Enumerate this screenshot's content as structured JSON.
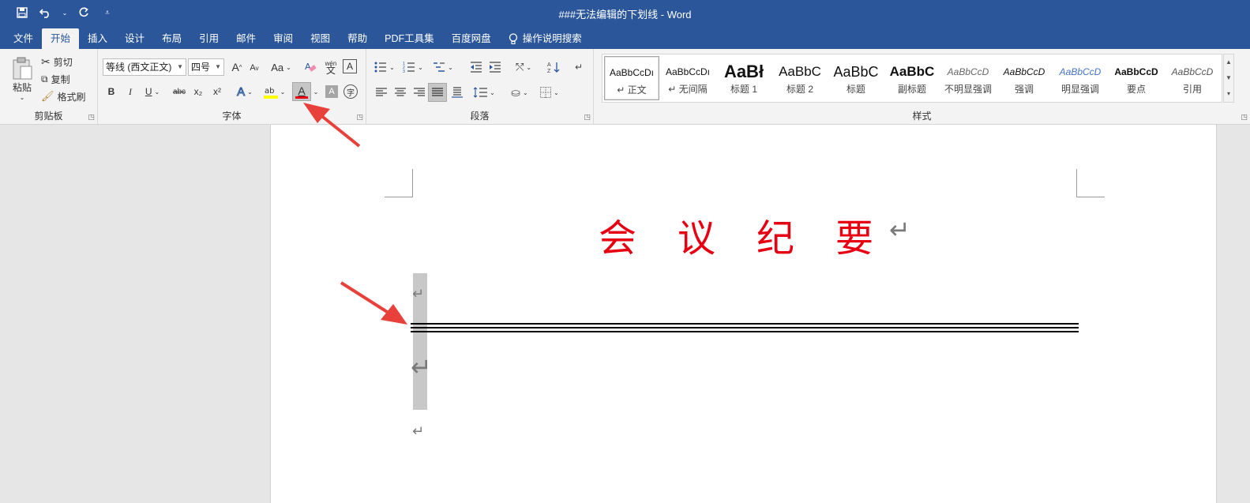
{
  "window": {
    "title": "###无法编辑的下划线  -  Word"
  },
  "qat": {
    "save_icon": "save-icon",
    "undo_icon": "undo-icon",
    "redo_icon": "redo-icon",
    "customize_icon": "customize-icon"
  },
  "tabs": [
    {
      "label": "文件"
    },
    {
      "label": "开始"
    },
    {
      "label": "插入"
    },
    {
      "label": "设计"
    },
    {
      "label": "布局"
    },
    {
      "label": "引用"
    },
    {
      "label": "邮件"
    },
    {
      "label": "审阅"
    },
    {
      "label": "视图"
    },
    {
      "label": "帮助"
    },
    {
      "label": "PDF工具集"
    },
    {
      "label": "百度网盘"
    }
  ],
  "tell_me": {
    "label": "操作说明搜索"
  },
  "clipboard": {
    "group_label": "剪贴板",
    "paste": "粘贴",
    "cut": "剪切",
    "copy": "复制",
    "format_painter": "格式刷"
  },
  "font": {
    "group_label": "字体",
    "font_name": "等线 (西文正文)",
    "font_size": "四号",
    "bold": "B",
    "italic": "I",
    "underline": "U",
    "strike": "abc",
    "subscript": "x₂",
    "superscript": "x²",
    "case": "Aa",
    "font_color_glyph": "A",
    "wen": "wén",
    "grow": "A",
    "shrink": "A",
    "font_color": "#e60012",
    "highlight_color": "#ffff00"
  },
  "paragraph": {
    "group_label": "段落"
  },
  "styles": {
    "group_label": "样式",
    "items": [
      {
        "sample": "AaBbCcDı",
        "name": "↵ 正文"
      },
      {
        "sample": "AaBbCcDı",
        "name": "↵ 无间隔"
      },
      {
        "sample": "AaBł",
        "name": "标题 1"
      },
      {
        "sample": "AaBbC",
        "name": "标题 2"
      },
      {
        "sample": "AaBbC",
        "name": "标题"
      },
      {
        "sample": "AaBbC",
        "name": "副标题"
      },
      {
        "sample": "AaBbCcD",
        "name": "不明显强调"
      },
      {
        "sample": "AaBbCcD",
        "name": "强调"
      },
      {
        "sample": "AaBbCcD",
        "name": "明显强调"
      },
      {
        "sample": "AaBbCcD",
        "name": "要点"
      },
      {
        "sample": "AaBbCcD",
        "name": "引用"
      }
    ]
  },
  "document": {
    "heading": "会议纪要",
    "paragraph_mark": "↵",
    "heading_color": "#e60012"
  },
  "annotation": {
    "arrow_color": "#e8403a"
  }
}
